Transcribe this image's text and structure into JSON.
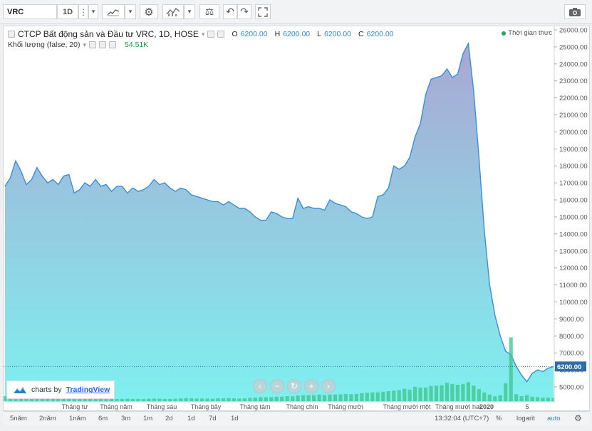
{
  "toolbar": {
    "symbol": "VRC",
    "interval": "1D",
    "more_glyph": "⋮",
    "dropdown_glyph": "▾",
    "settings_glyph": "⚙",
    "scale_glyph": "⚖",
    "undo_glyph": "↶",
    "redo_glyph": "↷",
    "fullscreen_glyph": "⛶",
    "camera_glyph": "📷"
  },
  "legend": {
    "title": "CTCP Bất động sản và Đầu tư VRC, 1D, HOSE",
    "title_caret": "▾",
    "open_label": "O",
    "open": "6200.00",
    "high_label": "H",
    "high": "6200.00",
    "low_label": "L",
    "low": "6200.00",
    "close_label": "C",
    "close": "6200.00",
    "volume_label": "Khối lượng (false, 20)",
    "volume_caret": "▾",
    "volume_value": "54.51K",
    "realtime": "Thời gian thực"
  },
  "brand": {
    "prefix": "charts by",
    "name": "TradingView"
  },
  "nav_controls": [
    "‹",
    "−",
    "↻",
    "+",
    "›"
  ],
  "price_axis": {
    "last_price_label": "6200.00",
    "ticks": [
      "26000.00",
      "25000.00",
      "24000.00",
      "23000.00",
      "22000.00",
      "21000.00",
      "20000.00",
      "19000.00",
      "18000.00",
      "17000.00",
      "16000.00",
      "15000.00",
      "14000.00",
      "13000.00",
      "12000.00",
      "11000.00",
      "10000.00",
      "9000.00",
      "8000.00",
      "7000.00",
      "6000.00",
      "5000.00"
    ]
  },
  "time_axis": [
    "Tháng tư",
    "Tháng năm",
    "Tháng sáu",
    "Tháng bảy",
    "Tháng tám",
    "Tháng chín",
    "Tháng mười",
    "Tháng mười một",
    "Tháng mười hai",
    "2020",
    "5"
  ],
  "bottom": {
    "ranges": [
      "5năm",
      "2năm",
      "1năm",
      "6m",
      "3m",
      "1m",
      "2d",
      "1d",
      "7d",
      "1d"
    ],
    "time": "13:32:04 (UTC+7)",
    "percent": "%",
    "log": "logarit",
    "auto": "auto",
    "gear_glyph": "⚙"
  },
  "colors": {
    "line": "#3a8fd6",
    "area_top": "#a9a7d3",
    "area_bottom": "#7ff0f0",
    "volume": "#3ec389",
    "last_price_bg": "#2e6da8"
  },
  "chart_data": {
    "type": "area",
    "title": "CTCP Bất động sản và Đầu tư VRC, 1D, HOSE",
    "xlabel": "",
    "ylabel": "",
    "ylim": [
      4300,
      26500
    ],
    "x_tick_labels": [
      "Tháng tư",
      "Tháng năm",
      "Tháng sáu",
      "Tháng bảy",
      "Tháng tám",
      "Tháng chín",
      "Tháng mười",
      "Tháng mười một",
      "Tháng mười hai",
      "2020",
      "5"
    ],
    "series": [
      {
        "values": [
          16800,
          17300,
          18300,
          17700,
          16900,
          17200,
          17900,
          17400,
          17000,
          17200,
          16900,
          17400,
          17500,
          16400,
          16600,
          17000,
          16800,
          17200,
          16800,
          16900,
          16500,
          16800,
          16800,
          16400,
          16700,
          16500,
          16600,
          16800,
          17200,
          16900,
          17000,
          16700,
          16500,
          16700,
          16600,
          16300,
          16200,
          16100,
          16000,
          15900,
          15900,
          15700,
          15900,
          15700,
          15500,
          15500,
          15300,
          15000,
          14800,
          14800,
          15300,
          15200,
          15000,
          14900,
          14900,
          16100,
          15500,
          15600,
          15500,
          15500,
          15400,
          16000,
          15800,
          15700,
          15600,
          15300,
          15200,
          15000,
          14900,
          15000,
          16200,
          16300,
          16700,
          18000,
          17800,
          18000,
          18500,
          19700,
          20500,
          22200,
          23100,
          23200,
          23300,
          23700,
          23200,
          23400,
          24600,
          25200,
          22400,
          18500,
          14200,
          11000,
          9200,
          8000,
          7100,
          6900,
          6200,
          5700,
          5300,
          5800,
          6000,
          5900,
          6100,
          6200
        ],
        "volume": [
          0.25,
          0.18,
          0.52,
          0.48,
          0.42,
          0.3,
          0.25,
          0.2,
          0.15,
          0.14,
          0.14,
          0.14,
          0.14,
          0.16,
          0.16,
          0.14,
          0.16,
          0.15,
          0.14,
          0.14,
          0.12,
          0.11,
          0.11,
          0.12,
          0.11,
          0.11,
          0.11,
          0.12,
          0.13,
          0.12,
          0.11,
          0.11,
          0.12,
          0.14,
          0.15,
          0.14,
          0.13,
          0.13,
          0.13,
          0.12,
          0.14,
          0.14,
          0.15,
          0.14,
          0.13,
          0.14,
          0.16,
          0.18,
          0.2,
          0.2,
          0.2,
          0.22,
          0.22,
          0.25,
          0.24,
          0.28,
          0.3,
          0.3,
          0.3,
          0.33,
          0.3,
          0.33,
          0.33,
          0.34,
          0.36,
          0.35,
          0.36,
          0.4,
          0.42,
          0.44,
          0.44,
          0.47,
          0.5,
          0.52,
          0.55,
          0.62,
          0.58,
          0.72,
          0.68,
          0.68,
          0.76,
          0.78,
          0.8,
          0.92,
          0.86,
          0.82,
          0.86,
          0.95,
          0.78,
          0.6,
          0.44,
          0.33,
          0.24,
          0.3,
          0.9,
          3.2,
          0.35,
          0.25,
          0.3,
          0.22,
          0.2,
          0.18,
          0.17,
          0.16
        ]
      }
    ],
    "last_price": 6200
  }
}
